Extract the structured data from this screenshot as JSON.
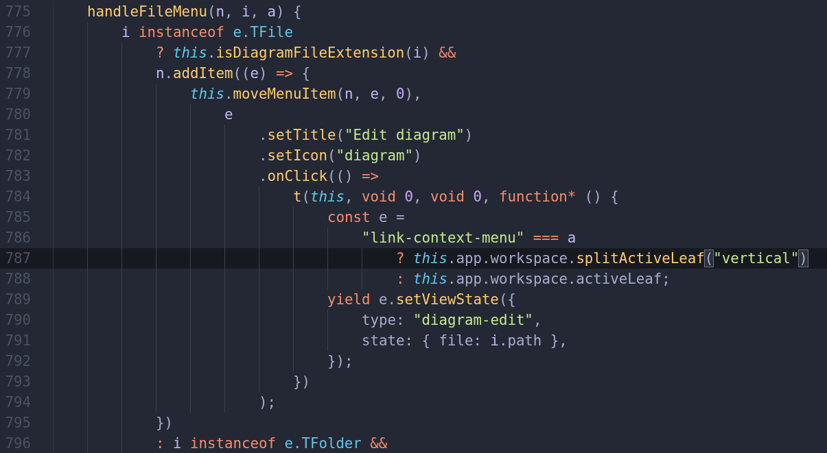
{
  "editor": {
    "lines": [
      {
        "number": "775",
        "current": false,
        "tokens": [
          {
            "kind": "fn",
            "text": "handleFileMenu"
          },
          {
            "kind": "punc",
            "text": "("
          },
          {
            "kind": "param",
            "text": "n"
          },
          {
            "kind": "punc",
            "text": ", "
          },
          {
            "kind": "param",
            "text": "i"
          },
          {
            "kind": "punc",
            "text": ", "
          },
          {
            "kind": "param",
            "text": "a"
          },
          {
            "kind": "punc",
            "text": ") {"
          }
        ],
        "children": [
          {
            "number": "776",
            "current": false,
            "tokens": [
              {
                "kind": "param",
                "text": "i "
              },
              {
                "kind": "kw",
                "text": "instanceof "
              },
              {
                "kind": "type",
                "text": "e.TFile"
              }
            ],
            "children": [
              {
                "number": "777",
                "current": false,
                "tokens": [
                  {
                    "kind": "op",
                    "text": "? "
                  },
                  {
                    "kind": "this",
                    "text": "this"
                  },
                  {
                    "kind": "punc",
                    "text": "."
                  },
                  {
                    "kind": "fn",
                    "text": "isDiagramFileExtension"
                  },
                  {
                    "kind": "punc",
                    "text": "("
                  },
                  {
                    "kind": "param",
                    "text": "i"
                  },
                  {
                    "kind": "punc",
                    "text": ") "
                  },
                  {
                    "kind": "op",
                    "text": "&&"
                  }
                ]
              },
              {
                "number": "778",
                "current": false,
                "tokens": [
                  {
                    "kind": "param",
                    "text": "n"
                  },
                  {
                    "kind": "punc",
                    "text": "."
                  },
                  {
                    "kind": "fn",
                    "text": "addItem"
                  },
                  {
                    "kind": "punc",
                    "text": "(("
                  },
                  {
                    "kind": "param",
                    "text": "e"
                  },
                  {
                    "kind": "punc",
                    "text": ") "
                  },
                  {
                    "kind": "op",
                    "text": "=>"
                  },
                  {
                    "kind": "punc",
                    "text": " {"
                  }
                ],
                "children": [
                  {
                    "number": "779",
                    "current": false,
                    "tokens": [
                      {
                        "kind": "this",
                        "text": "this"
                      },
                      {
                        "kind": "punc",
                        "text": "."
                      },
                      {
                        "kind": "fn",
                        "text": "moveMenuItem"
                      },
                      {
                        "kind": "punc",
                        "text": "("
                      },
                      {
                        "kind": "param",
                        "text": "n"
                      },
                      {
                        "kind": "punc",
                        "text": ", "
                      },
                      {
                        "kind": "param",
                        "text": "e"
                      },
                      {
                        "kind": "punc",
                        "text": ", "
                      },
                      {
                        "kind": "num",
                        "text": "0"
                      },
                      {
                        "kind": "punc",
                        "text": "),"
                      }
                    ],
                    "children": [
                      {
                        "number": "780",
                        "current": false,
                        "tokens": [
                          {
                            "kind": "param",
                            "text": "e"
                          }
                        ],
                        "children": [
                          {
                            "number": "781",
                            "current": false,
                            "tokens": [
                              {
                                "kind": "punc",
                                "text": "."
                              },
                              {
                                "kind": "fn",
                                "text": "setTitle"
                              },
                              {
                                "kind": "punc",
                                "text": "("
                              },
                              {
                                "kind": "str",
                                "text": "\"Edit diagram\""
                              },
                              {
                                "kind": "punc",
                                "text": ")"
                              }
                            ]
                          },
                          {
                            "number": "782",
                            "current": false,
                            "tokens": [
                              {
                                "kind": "punc",
                                "text": "."
                              },
                              {
                                "kind": "fn",
                                "text": "setIcon"
                              },
                              {
                                "kind": "punc",
                                "text": "("
                              },
                              {
                                "kind": "str",
                                "text": "\"diagram\""
                              },
                              {
                                "kind": "punc",
                                "text": ")"
                              }
                            ]
                          },
                          {
                            "number": "783",
                            "current": false,
                            "tokens": [
                              {
                                "kind": "punc",
                                "text": "."
                              },
                              {
                                "kind": "fn",
                                "text": "onClick"
                              },
                              {
                                "kind": "punc",
                                "text": "(() "
                              },
                              {
                                "kind": "op",
                                "text": "=>"
                              }
                            ],
                            "children": [
                              {
                                "number": "784",
                                "current": false,
                                "tokens": [
                                  {
                                    "kind": "fn",
                                    "text": "t"
                                  },
                                  {
                                    "kind": "punc",
                                    "text": "("
                                  },
                                  {
                                    "kind": "this",
                                    "text": "this"
                                  },
                                  {
                                    "kind": "punc",
                                    "text": ", "
                                  },
                                  {
                                    "kind": "kw",
                                    "text": "void "
                                  },
                                  {
                                    "kind": "num",
                                    "text": "0"
                                  },
                                  {
                                    "kind": "punc",
                                    "text": ", "
                                  },
                                  {
                                    "kind": "kw",
                                    "text": "void "
                                  },
                                  {
                                    "kind": "num",
                                    "text": "0"
                                  },
                                  {
                                    "kind": "punc",
                                    "text": ", "
                                  },
                                  {
                                    "kind": "kw",
                                    "text": "function*"
                                  },
                                  {
                                    "kind": "punc",
                                    "text": " () {"
                                  }
                                ],
                                "children": [
                                  {
                                    "number": "785",
                                    "current": false,
                                    "tokens": [
                                      {
                                        "kind": "kw",
                                        "text": "const"
                                      },
                                      {
                                        "kind": "punc",
                                        "text": " e ="
                                      }
                                    ],
                                    "children": [
                                      {
                                        "number": "786",
                                        "current": false,
                                        "tokens": [
                                          {
                                            "kind": "str",
                                            "text": "\"link-context-menu\" "
                                          },
                                          {
                                            "kind": "op",
                                            "text": "=== "
                                          },
                                          {
                                            "kind": "param",
                                            "text": "a"
                                          }
                                        ],
                                        "children": [
                                          {
                                            "number": "787",
                                            "current": true,
                                            "tokens": [
                                              {
                                                "kind": "op",
                                                "text": "? "
                                              },
                                              {
                                                "kind": "this",
                                                "text": "this"
                                              },
                                              {
                                                "kind": "punc",
                                                "text": ".app.workspace."
                                              },
                                              {
                                                "kind": "fn",
                                                "text": "splitActiveLeaf"
                                              },
                                              {
                                                "kind": "match",
                                                "text": "("
                                              },
                                              {
                                                "kind": "str",
                                                "text": "\"vertical\""
                                              },
                                              {
                                                "kind": "match",
                                                "text": ")"
                                              }
                                            ]
                                          },
                                          {
                                            "number": "788",
                                            "current": false,
                                            "tokens": [
                                              {
                                                "kind": "op",
                                                "text": ": "
                                              },
                                              {
                                                "kind": "this",
                                                "text": "this"
                                              },
                                              {
                                                "kind": "punc",
                                                "text": ".app.workspace.activeLeaf;"
                                              }
                                            ]
                                          }
                                        ]
                                      }
                                    ]
                                  },
                                  {
                                    "number": "789",
                                    "current": false,
                                    "tokens": [
                                      {
                                        "kind": "kw",
                                        "text": "yield"
                                      },
                                      {
                                        "kind": "punc",
                                        "text": " e."
                                      },
                                      {
                                        "kind": "fn",
                                        "text": "setViewState"
                                      },
                                      {
                                        "kind": "punc",
                                        "text": "({"
                                      }
                                    ],
                                    "children": [
                                      {
                                        "number": "790",
                                        "current": false,
                                        "tokens": [
                                          {
                                            "kind": "punc",
                                            "text": "type: "
                                          },
                                          {
                                            "kind": "str",
                                            "text": "\"diagram-edit\""
                                          },
                                          {
                                            "kind": "punc",
                                            "text": ","
                                          }
                                        ]
                                      },
                                      {
                                        "number": "791",
                                        "current": false,
                                        "tokens": [
                                          {
                                            "kind": "punc",
                                            "text": "state: { file: "
                                          },
                                          {
                                            "kind": "param",
                                            "text": "i"
                                          },
                                          {
                                            "kind": "punc",
                                            "text": ".path },"
                                          }
                                        ]
                                      }
                                    ]
                                  },
                                  {
                                    "number": "792",
                                    "current": false,
                                    "tokens": [
                                      {
                                        "kind": "punc",
                                        "text": "});"
                                      }
                                    ]
                                  }
                                ]
                              },
                              {
                                "number": "793",
                                "current": false,
                                "tokens": [
                                  {
                                    "kind": "punc",
                                    "text": "})"
                                  }
                                ]
                              }
                            ]
                          },
                          {
                            "number": "794",
                            "current": false,
                            "tokens": [
                              {
                                "kind": "punc",
                                "text": ");"
                              }
                            ]
                          }
                        ]
                      }
                    ]
                  }
                ]
              },
              {
                "number": "795",
                "current": false,
                "tokens": [
                  {
                    "kind": "punc",
                    "text": "})"
                  }
                ]
              },
              {
                "number": "796",
                "current": false,
                "tokens": [
                  {
                    "kind": "op",
                    "text": ": "
                  },
                  {
                    "kind": "param",
                    "text": "i "
                  },
                  {
                    "kind": "kw",
                    "text": "instanceof "
                  },
                  {
                    "kind": "type",
                    "text": "e.TFolder "
                  },
                  {
                    "kind": "op",
                    "text": "&&"
                  }
                ]
              }
            ]
          }
        ]
      }
    ]
  }
}
